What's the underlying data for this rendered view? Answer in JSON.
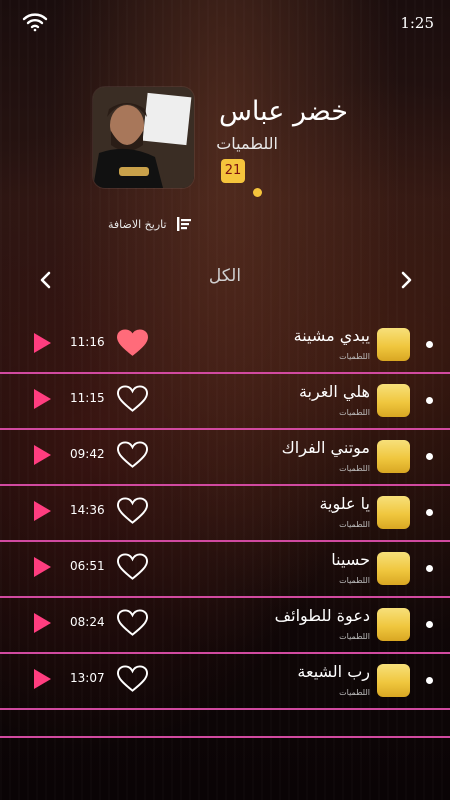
{
  "status": {
    "time": "1:25",
    "wifi_icon": "wifi-icon"
  },
  "artist": {
    "name": "خضر عباس",
    "category": "اللطميات",
    "count": "21",
    "avatar_icon": "artist-photo"
  },
  "sort": {
    "label": "تاريخ الاضافة",
    "icon": "sort-lines-icon"
  },
  "tab": {
    "title": "الكل",
    "prev_icon": "chevron-left-icon",
    "next_icon": "chevron-right-icon"
  },
  "colors": {
    "accent": "#f5c43c",
    "divider": "#d14aa0",
    "play": "#ff3d7f",
    "heart_active": "#ff6b7a"
  },
  "tracks": [
    {
      "title": "يبدي مشينة",
      "subtitle": "اللطميات",
      "duration": "11:16",
      "favorite": true
    },
    {
      "title": "هلي الغربة",
      "subtitle": "اللطميات",
      "duration": "11:15",
      "favorite": false
    },
    {
      "title": "موتني الفراك",
      "subtitle": "اللطميات",
      "duration": "09:42",
      "favorite": false
    },
    {
      "title": "يا علوية",
      "subtitle": "اللطميات",
      "duration": "14:36",
      "favorite": false
    },
    {
      "title": "حسينا",
      "subtitle": "اللطميات",
      "duration": "06:51",
      "favorite": false
    },
    {
      "title": "دعوة للطوائف",
      "subtitle": "اللطميات",
      "duration": "08:24",
      "favorite": false
    },
    {
      "title": "رب الشيعة",
      "subtitle": "اللطميات",
      "duration": "13:07",
      "favorite": false
    }
  ]
}
